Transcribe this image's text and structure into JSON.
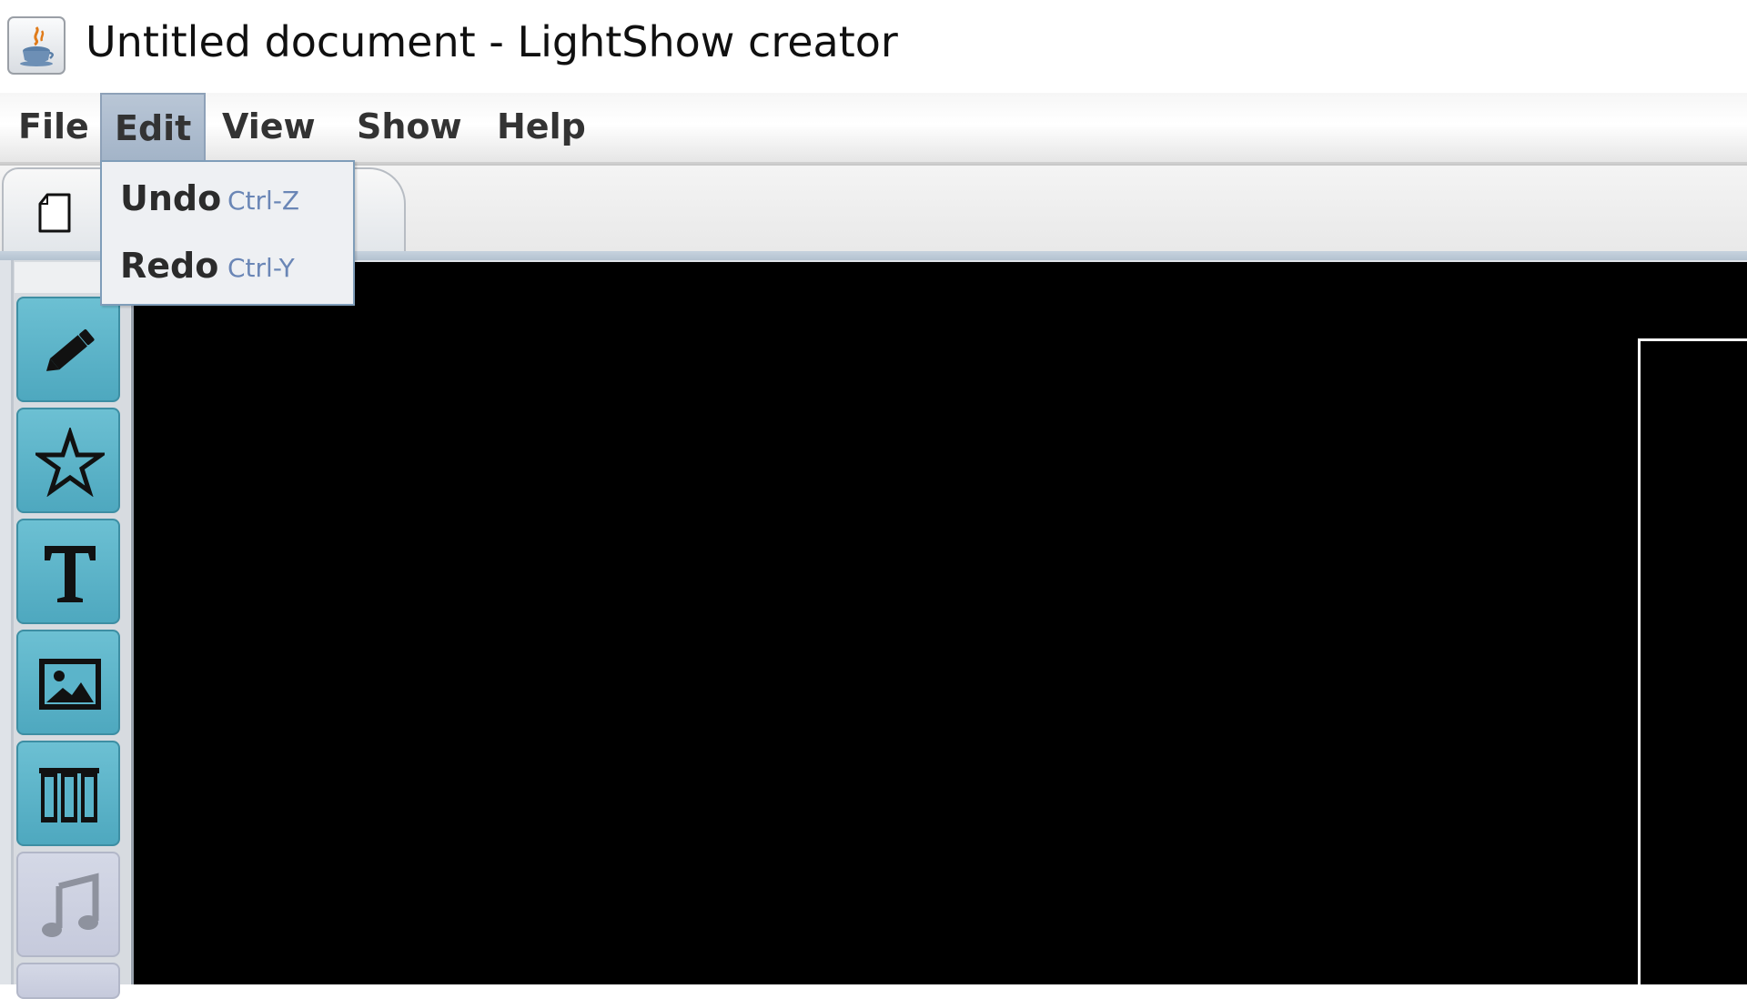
{
  "window": {
    "title": "Untitled document - LightShow creator",
    "icon": "java-cup-icon"
  },
  "menubar": {
    "items": [
      {
        "label": "File"
      },
      {
        "label": "Edit",
        "open": true
      },
      {
        "label": "View"
      },
      {
        "label": "Show"
      },
      {
        "label": "Help"
      }
    ]
  },
  "edit_menu": {
    "items": [
      {
        "label": "Undo",
        "shortcut": "Ctrl-Z"
      },
      {
        "label": "Redo",
        "shortcut": "Ctrl-Y"
      }
    ]
  },
  "tabs": [
    {
      "icon": "document-icon",
      "active": true
    }
  ],
  "tools": [
    {
      "name": "pencil-icon",
      "enabled": true
    },
    {
      "name": "star-icon",
      "enabled": true
    },
    {
      "name": "text-icon",
      "enabled": true
    },
    {
      "name": "image-icon",
      "enabled": true
    },
    {
      "name": "library-icon",
      "enabled": true
    },
    {
      "name": "music-note-icon",
      "enabled": false
    }
  ],
  "colors": {
    "tool_button": "#5bb4ca",
    "tool_button_disabled": "#cdd1e2",
    "canvas": "#000000",
    "menu_open": "#aebdd0"
  }
}
